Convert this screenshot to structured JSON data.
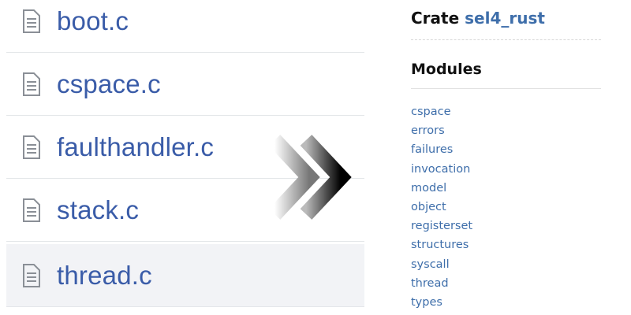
{
  "files": [
    {
      "name": "boot.c",
      "icon": "file-text-icon",
      "highlighted": false
    },
    {
      "name": "cspace.c",
      "icon": "file-text-icon",
      "highlighted": false
    },
    {
      "name": "faulthandler.c",
      "icon": "file-text-icon",
      "highlighted": false
    },
    {
      "name": "stack.c",
      "icon": "file-text-icon",
      "highlighted": false
    },
    {
      "name": "thread.c",
      "icon": "file-text-icon",
      "highlighted": true
    }
  ],
  "transition": {
    "icon": "double-chevron-right-icon"
  },
  "sidebar": {
    "crate_label": "Crate",
    "crate_name": "sel4_rust",
    "modules_heading": "Modules",
    "modules": [
      "cspace",
      "errors",
      "failures",
      "invocation",
      "model",
      "object",
      "registerset",
      "structures",
      "syscall",
      "thread",
      "types"
    ]
  },
  "colors": {
    "file_link": "#3a5ca8",
    "module_link": "#3e6eaa",
    "highlight_row": "#f2f3f6",
    "heading": "#111111"
  }
}
